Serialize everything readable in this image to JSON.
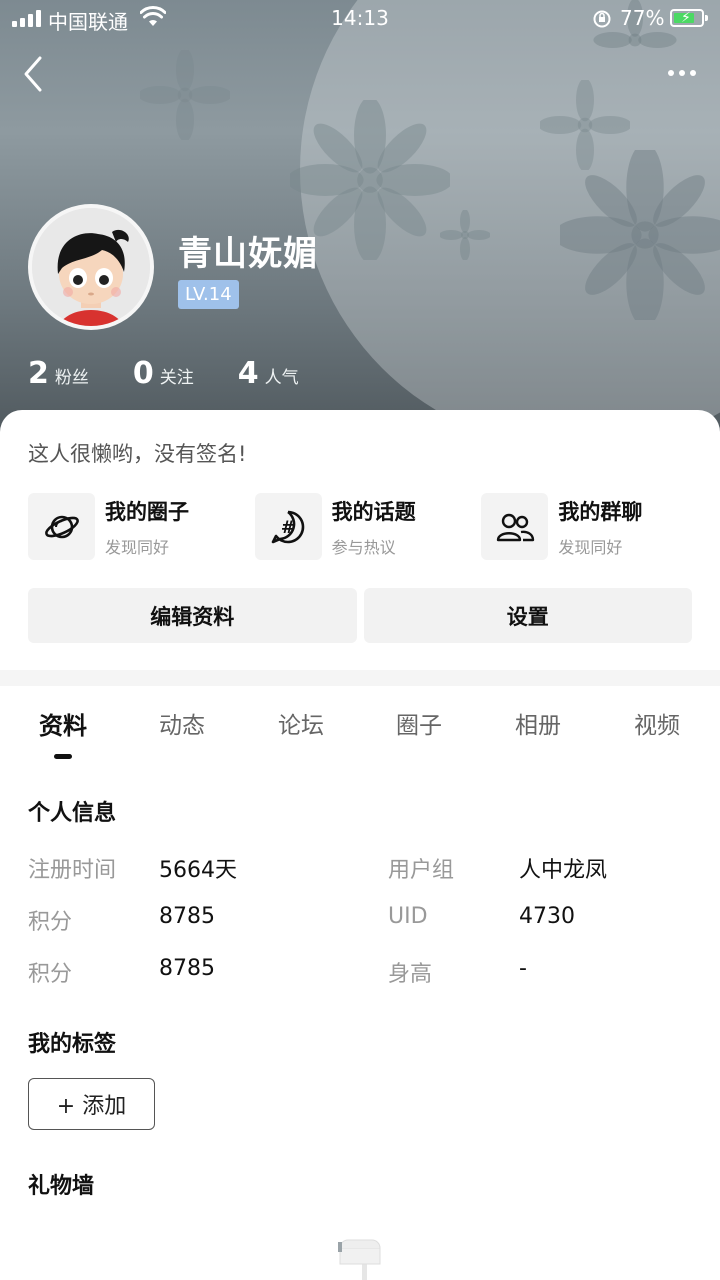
{
  "status_bar": {
    "carrier": "中国联通",
    "time": "14:13",
    "battery_percent": "77%",
    "battery_level": 0.77,
    "battery_color": "#4cd964"
  },
  "nav": {
    "back_icon": "chevron-left-icon",
    "more_icon": "more-dots-icon"
  },
  "profile": {
    "username": "青山妩媚",
    "level": "LV.14",
    "level_color": "#9fc1ea",
    "stats": [
      {
        "value": "2",
        "label": "粉丝"
      },
      {
        "value": "0",
        "label": "关注"
      },
      {
        "value": "4",
        "label": "人气"
      }
    ]
  },
  "card": {
    "bio": "这人很懒哟，没有签名!",
    "quick_links": [
      {
        "icon": "planet-icon",
        "title": "我的圈子",
        "subtitle": "发现同好"
      },
      {
        "icon": "hashtag-chat-icon",
        "title": "我的话题",
        "subtitle": "参与热议"
      },
      {
        "icon": "group-users-icon",
        "title": "我的群聊",
        "subtitle": "发现同好"
      }
    ],
    "edit_profile": "编辑资料",
    "settings": "设置"
  },
  "tabs": [
    "资料",
    "动态",
    "论坛",
    "圈子",
    "相册",
    "视频"
  ],
  "active_tab": "资料",
  "personal_info": {
    "title": "个人信息",
    "rows": [
      {
        "k1": "注册时间",
        "v1": "5664天",
        "k2": "用户组",
        "v2": "人中龙凤"
      },
      {
        "k1": "积分",
        "v1": "8785",
        "k2": "UID",
        "v2": "4730"
      },
      {
        "k1": "积分",
        "v1": "8785",
        "k2": "身高",
        "v2": "-"
      }
    ]
  },
  "tags": {
    "title": "我的标签",
    "add_button": "+ 添加"
  },
  "gifts": {
    "title": "礼物墙",
    "empty_icon": "mailbox-icon"
  }
}
